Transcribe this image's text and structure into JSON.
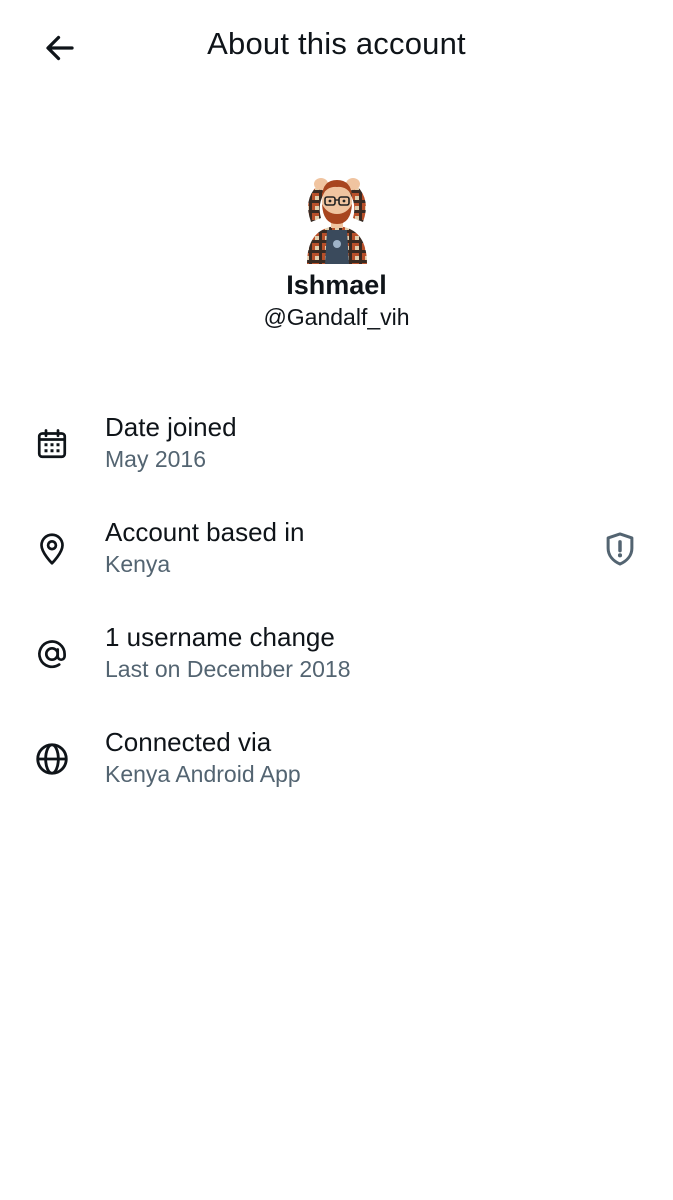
{
  "header": {
    "title": "About this account",
    "back_icon": "arrow-left-icon"
  },
  "profile": {
    "display_name": "Ishmael",
    "handle": "@Gandalf_vih",
    "avatar_icon": "cartoon-avatar"
  },
  "rows": [
    {
      "icon": "calendar-icon",
      "title": "Date joined",
      "subtitle": "May 2016"
    },
    {
      "icon": "location-pin-icon",
      "title": "Account based in",
      "subtitle": "Kenya",
      "badge_icon": "shield-alert-icon"
    },
    {
      "icon": "at-sign-icon",
      "title": "1 username change",
      "subtitle": "Last on December 2018"
    },
    {
      "icon": "globe-icon",
      "title": "Connected via",
      "subtitle": "Kenya Android App"
    }
  ],
  "colors": {
    "primary_text": "#0f1419",
    "secondary_text": "#536471",
    "background": "#ffffff"
  }
}
